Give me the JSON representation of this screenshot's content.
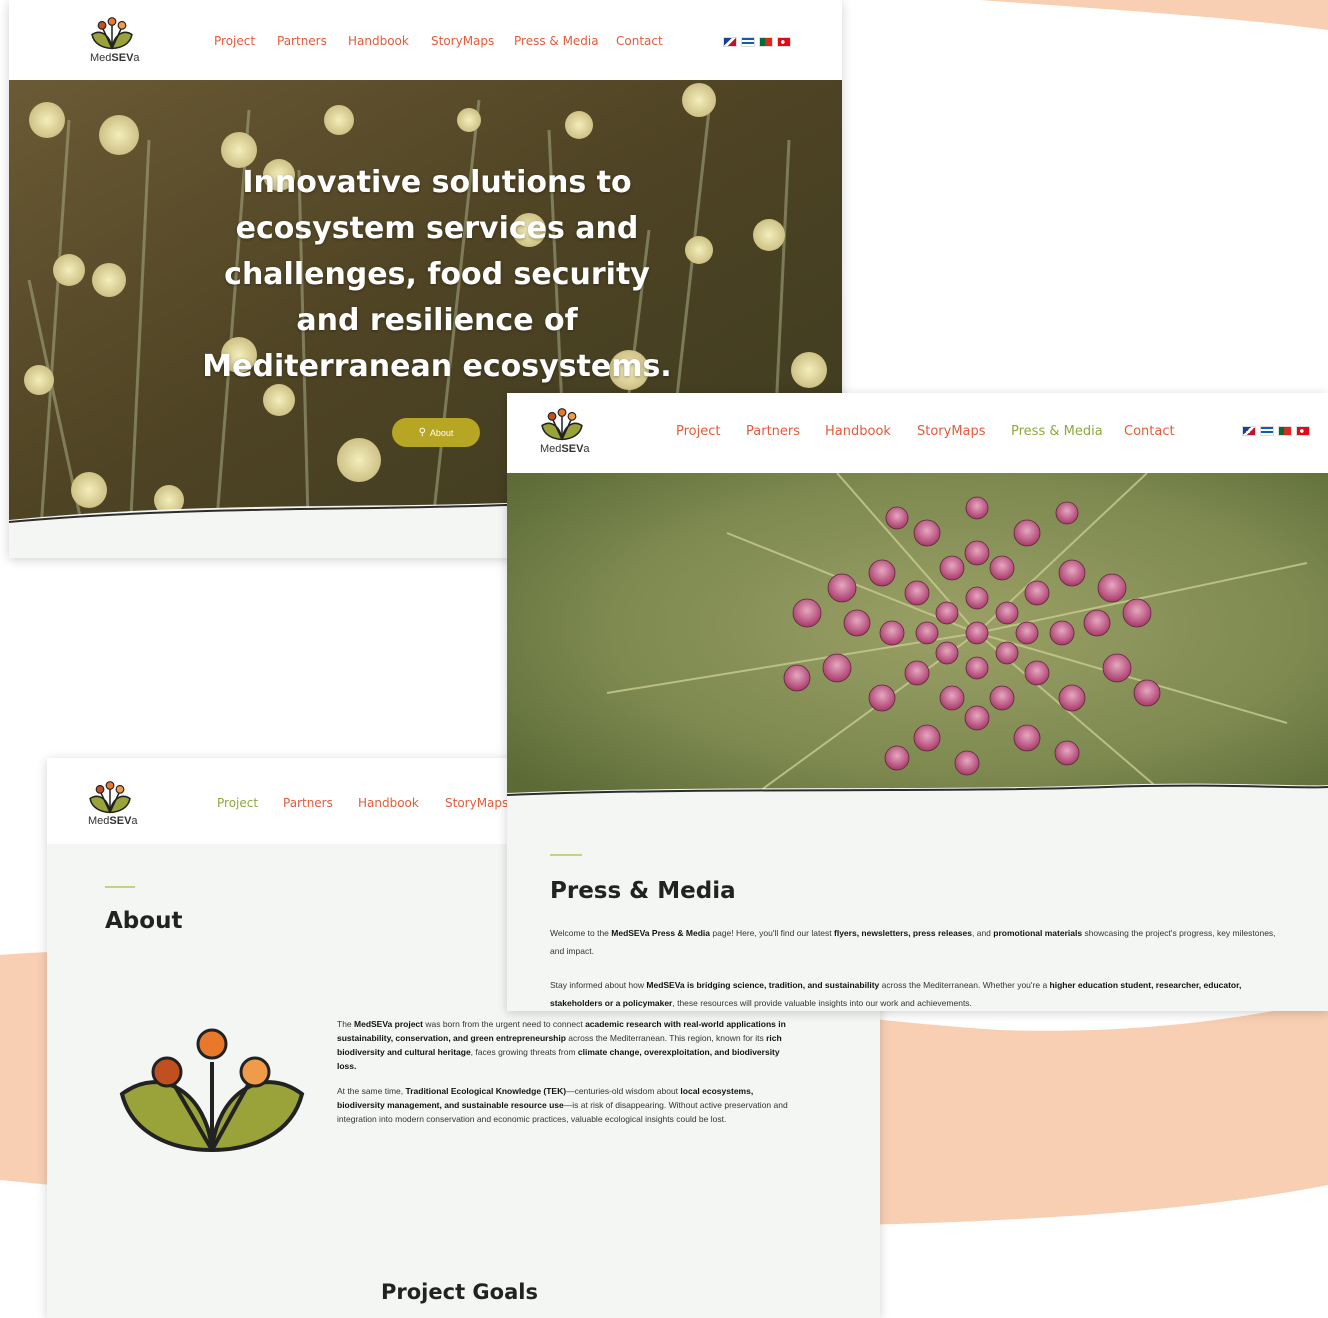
{
  "brand": {
    "logo_prefix": "Med",
    "logo_bold": "SEV",
    "logo_suffix": "a"
  },
  "nav_items": [
    "Project",
    "Partners",
    "Handbook",
    "StoryMaps",
    "Press & Media",
    "Contact"
  ],
  "languages": [
    "english-flag-icon",
    "greek-flag-icon",
    "portuguese-flag-icon",
    "turkish-flag-icon"
  ],
  "colors": {
    "nav_text": "#e15c3a",
    "nav_active": "#8ea93a",
    "button": "#b7a623",
    "peach_wave": "#f9cfb3",
    "page_bg": "#f4f6f4"
  },
  "home": {
    "hero_title": "Innovative solutions to ecosystem services and challenges, food security and resilience of Mediterranean ecosystems.",
    "about_button": "About"
  },
  "press": {
    "title": "Press & Media",
    "p1": {
      "t1": "Welcome to the ",
      "b1": "MedSEVa Press & Media",
      "t2": " page! Here, you'll find our latest ",
      "b2": "flyers, newsletters, press releases",
      "t3": ", and ",
      "b3": "promotional materials",
      "t4": " showcasing the project's progress, key milestones, and impact."
    },
    "p2": {
      "t1": "Stay informed about how ",
      "b1": "MedSEVa is bridging science, tradition, and sustainability",
      "t2": " across the Mediterranean. Whether you're a ",
      "b2": "higher education student, researcher, educator, stakeholders or a policymaker",
      "t3": ", these resources will provide valuable insights into our work and achievements."
    }
  },
  "about": {
    "title": "About",
    "goals_title": "Project Goals",
    "p1": {
      "t1": "The ",
      "b1": "MedSEVa project",
      "t2": " was born from the urgent need to connect ",
      "b2": "academic research with real-world applications in sustainability, conservation, and green entrepreneurship",
      "t3": " across the Mediterranean. This region, known for its ",
      "b3": "rich biodiversity and cultural heritage",
      "t4": ", faces growing threats from ",
      "b4": "climate change, overexploitation, and biodiversity loss."
    },
    "p2": {
      "t1": "At the same time, ",
      "b1": "Traditional Ecological Knowledge (TEK)",
      "t2": "—centuries-old wisdom about ",
      "b2": "local ecosystems, biodiversity management, and sustainable resource use",
      "t3": "—is at risk of disappearing. Without active preservation and integration into modern conservation and economic practices, valuable ecological insights could be lost."
    }
  }
}
